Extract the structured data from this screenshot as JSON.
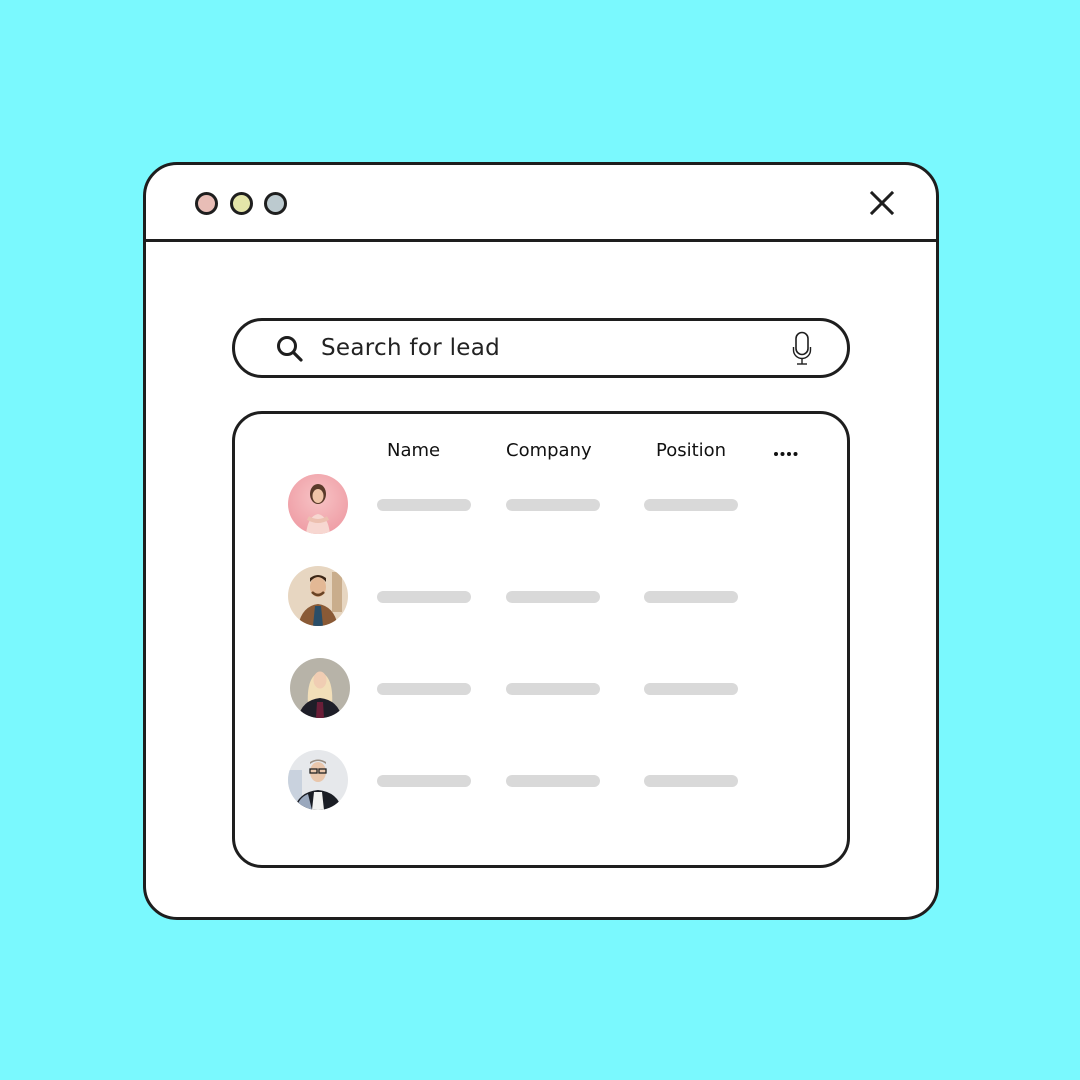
{
  "window": {
    "traffic_lights": [
      {
        "name": "red",
        "color": "#e8bdb6"
      },
      {
        "name": "yellow",
        "color": "#e4e5a9"
      },
      {
        "name": "blue-gray",
        "color": "#bccacf"
      }
    ],
    "close_icon": "close-icon"
  },
  "search": {
    "placeholder": "Search for lead",
    "value": "",
    "icons": {
      "left": "search-icon",
      "right": "microphone-icon"
    }
  },
  "table": {
    "columns": [
      "Name",
      "Company",
      "Position"
    ],
    "more_icon": "more-horizontal-icon",
    "rows": [
      {
        "avatar": "woman-pink-background",
        "avatar_colors": [
          "#f3b1b7",
          "#f7d4cf",
          "#5a3a2a"
        ],
        "name": "",
        "company": "",
        "position": ""
      },
      {
        "avatar": "man-brown-jacket",
        "avatar_colors": [
          "#e6d5c0",
          "#8a5a36",
          "#2a4e68"
        ],
        "name": "",
        "company": "",
        "position": ""
      },
      {
        "avatar": "blonde-woman-black-blazer",
        "avatar_colors": [
          "#b9b5ab",
          "#f1deb8",
          "#1e1e28"
        ],
        "name": "",
        "company": "",
        "position": ""
      },
      {
        "avatar": "man-glasses-dark-suit",
        "avatar_colors": [
          "#e5e7ea",
          "#9aa8bd",
          "#1a1d24"
        ],
        "name": "",
        "company": "",
        "position": ""
      }
    ]
  }
}
